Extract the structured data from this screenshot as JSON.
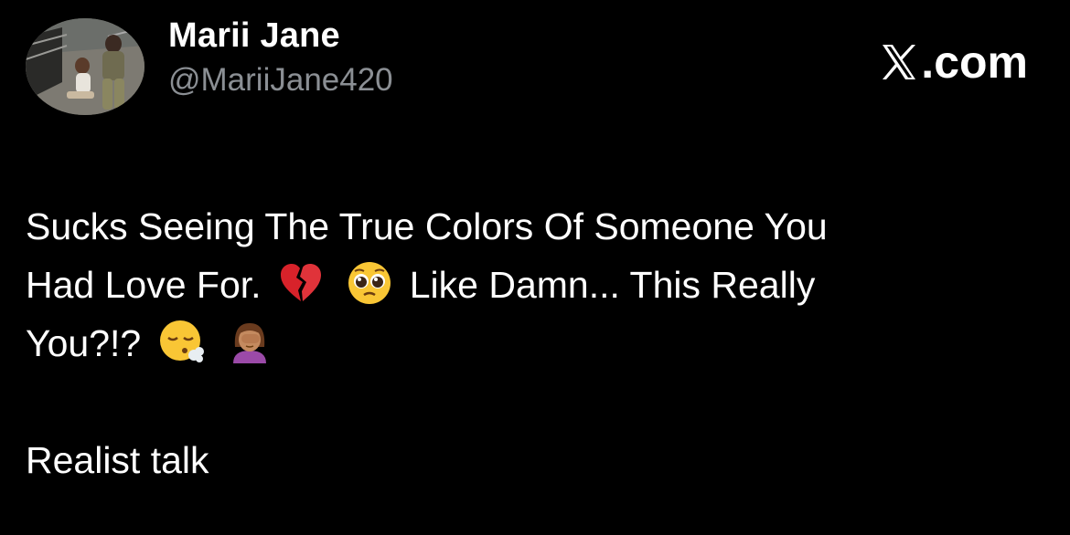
{
  "author": {
    "display_name": "Marii Jane",
    "handle": "@MariiJane420"
  },
  "brand": {
    "label": "com",
    "dot": ".",
    "icon": "x-logo-icon"
  },
  "tweet": {
    "line1": "Sucks Seeing The True Colors Of Someone You",
    "line2_a": "Had Love For.",
    "line2_b": "Like Damn... This Really",
    "line3_a": "You?!?",
    "paragraph2": "Realist talk",
    "emojis": [
      "broken-heart-emoji",
      "pleading-face-emoji",
      "face-exhaling-emoji",
      "woman-facepalming-emoji"
    ]
  }
}
